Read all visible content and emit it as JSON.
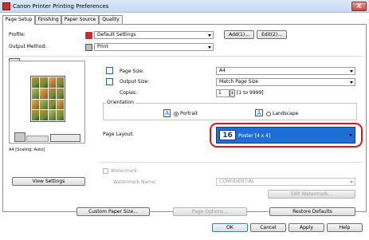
{
  "window": {
    "title": "Canon Printer Printing Preferences",
    "close_label": "X"
  },
  "tabs": [
    {
      "label": "Page Setup"
    },
    {
      "label": "Finishing"
    },
    {
      "label": "Paper Source"
    },
    {
      "label": "Quality"
    }
  ],
  "profile": {
    "label": "Profile:",
    "value": "Default Settings",
    "add_label": "Add(1)...",
    "edit_label": "Edit(2)..."
  },
  "output_method": {
    "label": "Output Method:",
    "value": "Print"
  },
  "page_size": {
    "label": "Page Size:",
    "value": "A4"
  },
  "output_size": {
    "label": "Output Size:",
    "value": "Match Page Size"
  },
  "copies": {
    "label": "Copies:",
    "value": "1",
    "range": "[1 to 9999]"
  },
  "orientation": {
    "label": "Orientation",
    "portrait_label": "Portrait",
    "landscape_label": "Landscape",
    "selected": "portrait"
  },
  "page_layout": {
    "label": "Page Layout:",
    "badge": "16",
    "value": "Poster [4 x 4]",
    "highlight_color": "#e0151a"
  },
  "preview": {
    "caption": "A4 [Scaling: Auto]",
    "view_settings_label": "View Settings"
  },
  "watermark": {
    "label": "Watermark",
    "name_label": "Watermark Name:",
    "name_value": "CONFIDENTIAL",
    "edit_label": "Edit Watermark..."
  },
  "bottom": {
    "custom_paper_label": "Custom Paper Size...",
    "page_options_label": "Page Options...",
    "restore_label": "Restore Defaults"
  },
  "footer": {
    "ok_label": "OK",
    "cancel_label": "Cancel",
    "apply_label": "Apply",
    "help_label": "Help"
  }
}
